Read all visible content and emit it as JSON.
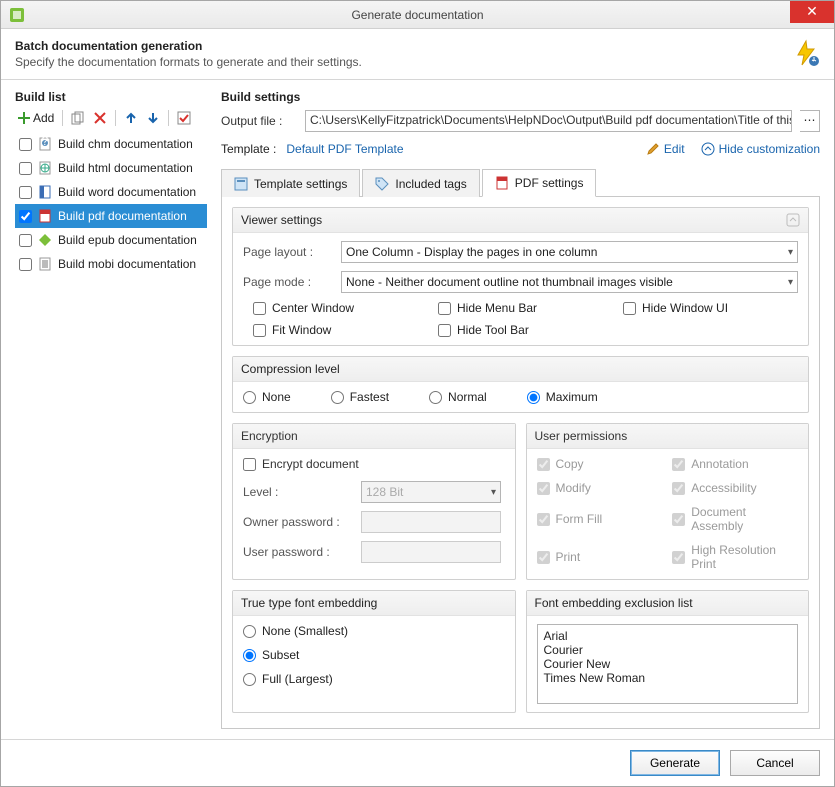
{
  "window": {
    "title": "Generate documentation"
  },
  "header": {
    "title": "Batch documentation generation",
    "subtitle": "Specify the documentation formats to generate and their settings."
  },
  "buildList": {
    "title": "Build list",
    "addLabel": "Add",
    "items": [
      {
        "label": "Build chm documentation",
        "checked": false,
        "selected": false,
        "icon": "chm"
      },
      {
        "label": "Build html documentation",
        "checked": false,
        "selected": false,
        "icon": "html"
      },
      {
        "label": "Build word documentation",
        "checked": false,
        "selected": false,
        "icon": "word"
      },
      {
        "label": "Build pdf documentation",
        "checked": true,
        "selected": true,
        "icon": "pdf"
      },
      {
        "label": "Build epub documentation",
        "checked": false,
        "selected": false,
        "icon": "epub"
      },
      {
        "label": "Build mobi documentation",
        "checked": false,
        "selected": false,
        "icon": "mobi"
      }
    ]
  },
  "buildSettings": {
    "title": "Build settings",
    "outputLabel": "Output file :",
    "outputPath": "C:\\Users\\KellyFitzpatrick\\Documents\\HelpNDoc\\Output\\Build pdf documentation\\Title of this help project.pd",
    "templateLabel": "Template :",
    "templateName": "Default PDF Template",
    "editLabel": "Edit",
    "hideLabel": "Hide customization",
    "tabs": {
      "template": "Template settings",
      "included": "Included tags",
      "pdf": "PDF settings"
    }
  },
  "viewer": {
    "title": "Viewer settings",
    "pageLayoutLabel": "Page layout :",
    "pageLayoutValue": "One Column - Display the pages in one column",
    "pageModeLabel": "Page mode :",
    "pageModeValue": "None - Neither document outline not thumbnail images visible",
    "centerWindow": "Center Window",
    "hideMenuBar": "Hide Menu Bar",
    "hideWindowUI": "Hide Window UI",
    "fitWindow": "Fit Window",
    "hideToolBar": "Hide Tool Bar"
  },
  "compression": {
    "title": "Compression level",
    "none": "None",
    "fastest": "Fastest",
    "normal": "Normal",
    "maximum": "Maximum",
    "selected": "maximum"
  },
  "encryption": {
    "title": "Encryption",
    "encryptLabel": "Encrypt document",
    "levelLabel": "Level :",
    "levelValue": "128 Bit",
    "ownerPwdLabel": "Owner password :",
    "userPwdLabel": "User password :"
  },
  "permissions": {
    "title": "User permissions",
    "copy": "Copy",
    "annotation": "Annotation",
    "modify": "Modify",
    "accessibility": "Accessibility",
    "formFill": "Form Fill",
    "docAssembly": "Document Assembly",
    "print": "Print",
    "highRes": "High Resolution Print"
  },
  "fontEmbed": {
    "title": "True type font embedding",
    "none": "None (Smallest)",
    "subset": "Subset",
    "full": "Full (Largest)",
    "selected": "subset"
  },
  "exclusion": {
    "title": "Font embedding exclusion list",
    "items": [
      "Arial",
      "Courier",
      "Courier New",
      "Times New Roman"
    ]
  },
  "footer": {
    "generate": "Generate",
    "cancel": "Cancel"
  }
}
